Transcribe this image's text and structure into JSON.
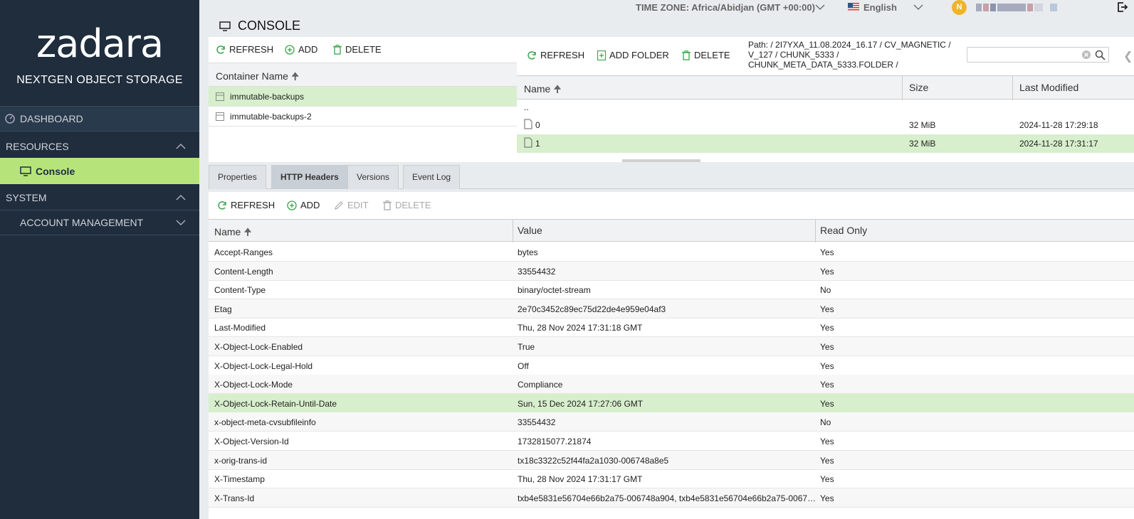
{
  "sidebar": {
    "logo": "zadara",
    "tagline": "NEXTGEN OBJECT STORAGE",
    "dashboard": "DASHBOARD",
    "resources": "RESOURCES",
    "console": "Console",
    "system": "SYSTEM",
    "account_management": "ACCOUNT MANAGEMENT"
  },
  "topbar": {
    "timezone": "TIME ZONE: Africa/Abidjan (GMT +00:00)",
    "language": "English",
    "user_initial": "N"
  },
  "page_title": "CONSOLE",
  "containers": {
    "toolbar": {
      "refresh": "REFRESH",
      "add": "ADD",
      "delete": "DELETE"
    },
    "column_header": "Container Name",
    "items": [
      {
        "name": "immutable-backups"
      },
      {
        "name": "immutable-backups-2"
      }
    ]
  },
  "files": {
    "toolbar": {
      "refresh": "REFRESH",
      "add_folder": "ADD FOLDER",
      "delete": "DELETE"
    },
    "path": "Path: / 2I7YXA_11.08.2024_16.17 / CV_MAGNETIC / V_127 / CHUNK_5333 / CHUNK_META_DATA_5333.FOLDER /",
    "columns": {
      "name": "Name",
      "size": "Size",
      "last_modified": "Last Modified"
    },
    "parent": "..",
    "rows": [
      {
        "name": "0",
        "size": "32 MiB",
        "modified": "2024-11-28 17:29:18"
      },
      {
        "name": "1",
        "size": "32 MiB",
        "modified": "2024-11-28 17:31:17"
      }
    ]
  },
  "tabs": [
    {
      "label": "Properties"
    },
    {
      "label": "HTTP Headers"
    },
    {
      "label": "Versions"
    },
    {
      "label": "Event Log"
    }
  ],
  "headers": {
    "toolbar": {
      "refresh": "REFRESH",
      "add": "ADD",
      "edit": "EDIT",
      "delete": "DELETE"
    },
    "columns": {
      "name": "Name",
      "value": "Value",
      "read_only": "Read Only"
    },
    "rows": [
      {
        "name": "Accept-Ranges",
        "value": "bytes",
        "ro": "Yes"
      },
      {
        "name": "Content-Length",
        "value": "33554432",
        "ro": "Yes"
      },
      {
        "name": "Content-Type",
        "value": "binary/octet-stream",
        "ro": "No"
      },
      {
        "name": "Etag",
        "value": "2e70c3452c89ec75d22de4e959e04af3",
        "ro": "Yes"
      },
      {
        "name": "Last-Modified",
        "value": "Thu, 28 Nov 2024 17:31:18 GMT",
        "ro": "Yes"
      },
      {
        "name": "X-Object-Lock-Enabled",
        "value": "True",
        "ro": "Yes"
      },
      {
        "name": "X-Object-Lock-Legal-Hold",
        "value": "Off",
        "ro": "Yes"
      },
      {
        "name": "X-Object-Lock-Mode",
        "value": "Compliance",
        "ro": "Yes"
      },
      {
        "name": "X-Object-Lock-Retain-Until-Date",
        "value": "Sun, 15 Dec 2024 17:27:06 GMT",
        "ro": "Yes"
      },
      {
        "name": "x-object-meta-cvsubfileinfo",
        "value": "33554432",
        "ro": "No"
      },
      {
        "name": "X-Object-Version-Id",
        "value": "1732815077.21874",
        "ro": "Yes"
      },
      {
        "name": "x-orig-trans-id",
        "value": "tx18c3322c52f44fa2a1030-006748a8e5",
        "ro": "Yes"
      },
      {
        "name": "X-Timestamp",
        "value": "Thu, 28 Nov 2024 17:31:17 GMT",
        "ro": "Yes"
      },
      {
        "name": "X-Trans-Id",
        "value": "txb4e5831e56704e66b2a75-006748a904, txb4e5831e56704e66b2a75-0067…",
        "ro": "Yes"
      }
    ]
  },
  "colors": {
    "sidebar": "#1f2d3d",
    "accent": "#b6e47b",
    "selected_row": "#d7efcc",
    "icon_green": "#3aa34a"
  }
}
